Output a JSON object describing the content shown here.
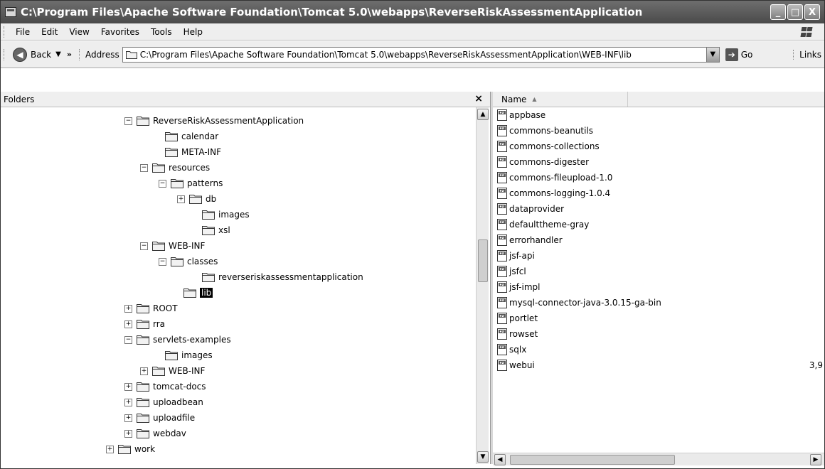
{
  "window": {
    "title": "C:\\Program Files\\Apache Software Foundation\\Tomcat 5.0\\webapps\\ReverseRiskAssessmentApplication",
    "minimize": "_",
    "maximize": "□",
    "close": "X"
  },
  "menu": [
    "File",
    "Edit",
    "View",
    "Favorites",
    "Tools",
    "Help"
  ],
  "toolbar": {
    "back_label": "Back",
    "more": "»",
    "address_label": "Address",
    "address_value": "C:\\Program Files\\Apache Software Foundation\\Tomcat 5.0\\webapps\\ReverseRiskAssessmentApplication\\WEB-INF\\lib",
    "go_label": "Go",
    "links_label": "Links"
  },
  "folders_pane": {
    "title": "Folders",
    "close": "×",
    "tree": [
      {
        "label": "ReverseRiskAssessmentApplication",
        "expander": "−"
      },
      {
        "label": "calendar",
        "expander": ""
      },
      {
        "label": "META-INF",
        "expander": ""
      },
      {
        "label": "resources",
        "expander": "−"
      },
      {
        "label": "patterns",
        "expander": "−"
      },
      {
        "label": "db",
        "expander": "+"
      },
      {
        "label": "images",
        "expander": ""
      },
      {
        "label": "xsl",
        "expander": ""
      },
      {
        "label": "WEB-INF",
        "expander": "−"
      },
      {
        "label": "classes",
        "expander": "−"
      },
      {
        "label": "reverseriskassessmentapplication",
        "expander": ""
      },
      {
        "label": "lib",
        "expander": "",
        "selected": true
      },
      {
        "label": "ROOT",
        "expander": "+"
      },
      {
        "label": "rra",
        "expander": "+"
      },
      {
        "label": "servlets-examples",
        "expander": "−"
      },
      {
        "label": "images",
        "expander": ""
      },
      {
        "label": "WEB-INF",
        "expander": "+"
      },
      {
        "label": "tomcat-docs",
        "expander": "+"
      },
      {
        "label": "uploadbean",
        "expander": "+"
      },
      {
        "label": "uploadfile",
        "expander": "+"
      },
      {
        "label": "webdav",
        "expander": "+"
      },
      {
        "label": "work",
        "expander": "+"
      }
    ]
  },
  "file_list": {
    "column_name": "Name",
    "files": [
      {
        "name": "appbase",
        "size": ""
      },
      {
        "name": "commons-beanutils",
        "size": ""
      },
      {
        "name": "commons-collections",
        "size": ""
      },
      {
        "name": "commons-digester",
        "size": ""
      },
      {
        "name": "commons-fileupload-1.0",
        "size": ""
      },
      {
        "name": "commons-logging-1.0.4",
        "size": ""
      },
      {
        "name": "dataprovider",
        "size": ""
      },
      {
        "name": "defaulttheme-gray",
        "size": ""
      },
      {
        "name": "errorhandler",
        "size": ""
      },
      {
        "name": "jsf-api",
        "size": ""
      },
      {
        "name": "jsfcl",
        "size": ""
      },
      {
        "name": "jsf-impl",
        "size": ""
      },
      {
        "name": "mysql-connector-java-3.0.15-ga-bin",
        "size": ""
      },
      {
        "name": "portlet",
        "size": ""
      },
      {
        "name": "rowset",
        "size": ""
      },
      {
        "name": "sqlx",
        "size": ""
      },
      {
        "name": "webui",
        "size": "3,9"
      }
    ]
  },
  "colors": {
    "titlebar": "#5a5a5a",
    "selection": "#000000",
    "pane_header": "#efefef"
  },
  "icons": {
    "folder": "folder-icon",
    "jar": "jar-file-icon",
    "back": "back-arrow-icon",
    "go": "go-arrow-icon"
  }
}
